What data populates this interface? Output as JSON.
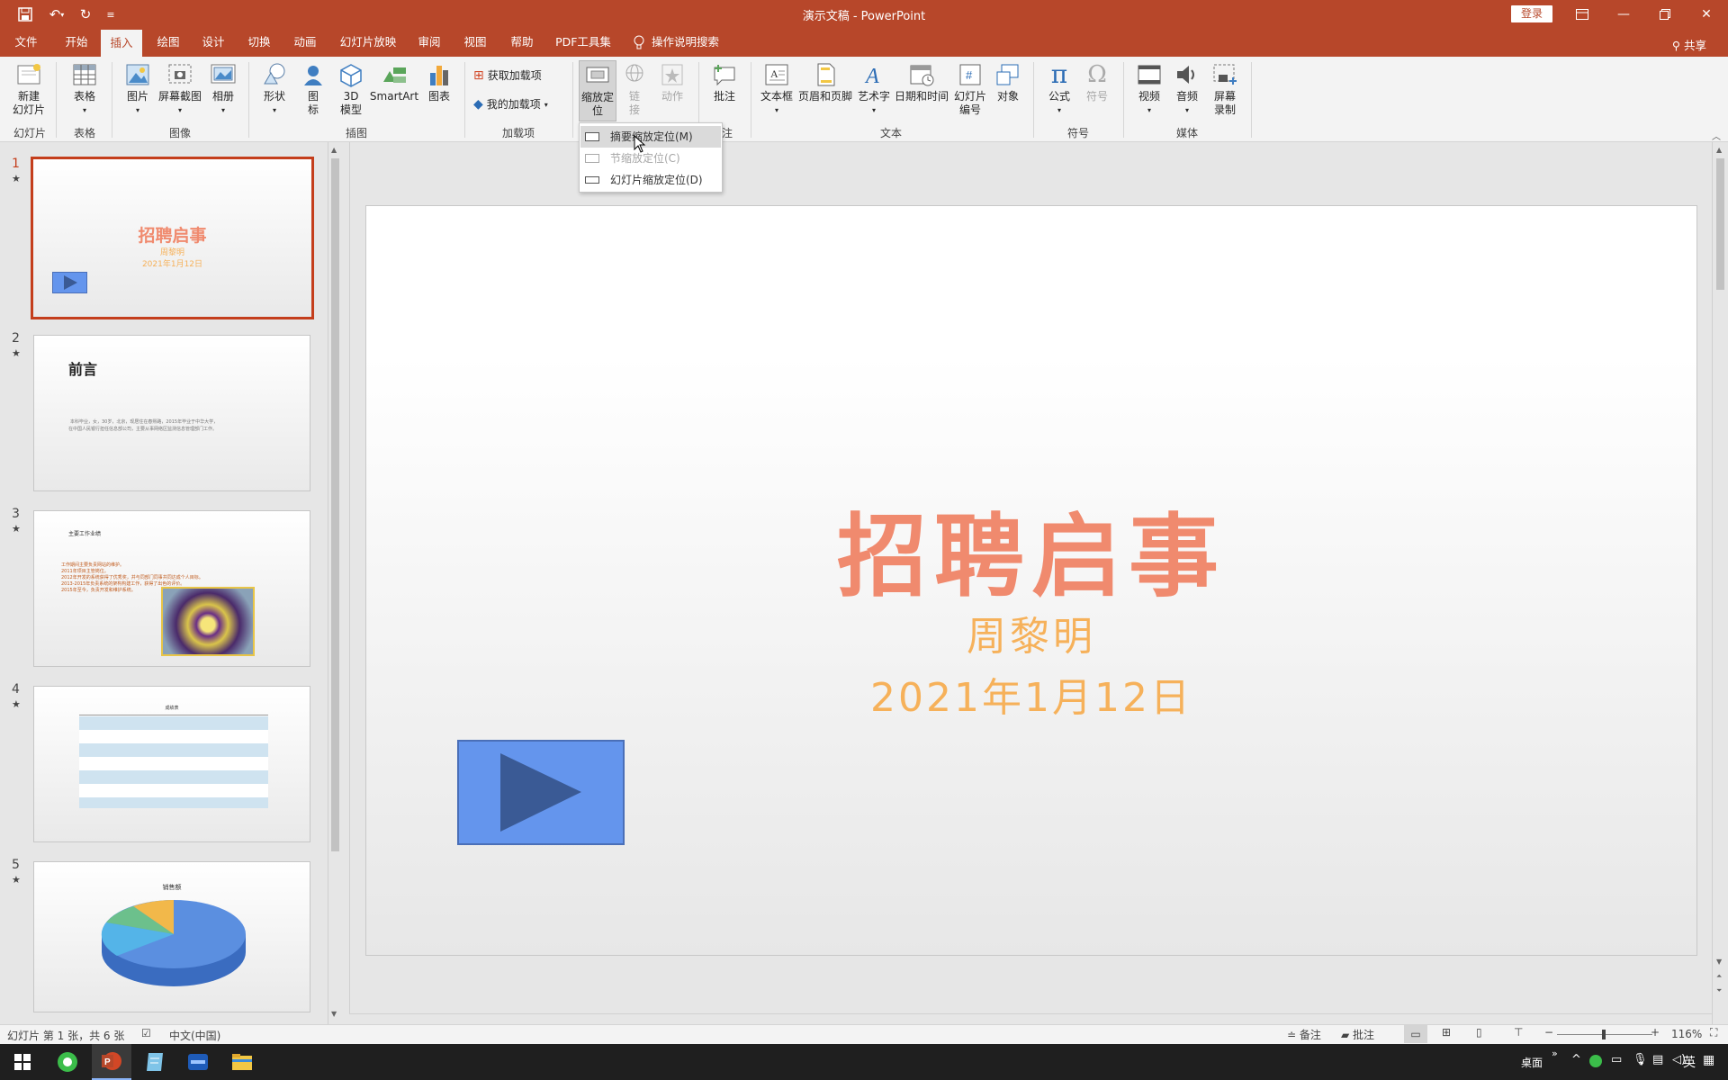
{
  "window": {
    "title": "演示文稿  -  PowerPoint",
    "login": "登录",
    "share": "共享"
  },
  "tabs": [
    "文件",
    "开始",
    "插入",
    "绘图",
    "设计",
    "切换",
    "动画",
    "幻灯片放映",
    "审阅",
    "视图",
    "帮助",
    "PDF工具集"
  ],
  "tell_me": "操作说明搜索",
  "ribbon": {
    "new_slide": "新建\n幻灯片",
    "table": "表格",
    "picture": "图片",
    "screenshot": "屏幕截图",
    "album": "相册",
    "shapes": "形状",
    "icons": "图\n标",
    "model3d": "3D\n模型",
    "smartart": "SmartArt",
    "chart": "图表",
    "get_addins": "获取加载项",
    "my_addins": "我的加载项",
    "zoom": "缩放定\n位",
    "link": "链\n接",
    "action": "动作",
    "comment": "批注",
    "textbox": "文本框",
    "header_footer": "页眉和页脚",
    "wordart": "艺术字",
    "datetime": "日期和时间",
    "slide_number": "幻灯片\n编号",
    "object": "对象",
    "equation": "公式",
    "symbol": "符号",
    "video": "视频",
    "audio": "音频",
    "screen_rec": "屏幕\n录制",
    "groups": {
      "slides": "幻灯片",
      "tables": "表格",
      "images": "图像",
      "illustrations": "插图",
      "addins": "加载项",
      "comments": "注",
      "text": "文本",
      "symbols": "符号",
      "media": "媒体"
    }
  },
  "zoom_menu": {
    "items": [
      "摘要缩放定位(M)",
      "节缩放定位(C)",
      "幻灯片缩放定位(D)"
    ]
  },
  "thumbs": {
    "numbers": [
      "1",
      "2",
      "3",
      "4",
      "5"
    ],
    "s1": {
      "title": "招聘启事",
      "sub": "周黎明",
      "date": "2021年1月12日"
    },
    "s2": {
      "title": "前言",
      "line1": "本科毕业，女，30岁，北京，现居住在春熙路，2015年毕业于中华大学，",
      "line2": "在中国人民银行担任信息部公司，主要从事网络区监测信息管理部门工作。"
    },
    "s3": {
      "title": "主要工作业绩",
      "l1": "工作期间主要负责网站的维护。",
      "l2": "2011年项目主管岗位。",
      "l3": "2012年开发的系统获得了优秀奖，并与同部门同事共同达成个人目标。",
      "l4": "2013-2015年负责系统的架构构建工作，获得了出色的评价。",
      "l5": "2015年至今，负责开发和维护系统。"
    },
    "s4": {
      "title": "成绩表"
    },
    "s5": {
      "title": "销售额"
    }
  },
  "slide": {
    "title": "招聘启事",
    "subtitle": "周黎明",
    "date": "2021年1月12日"
  },
  "status": {
    "slide_info": "幻灯片 第 1 张，共 6 张",
    "language": "中文(中国)",
    "notes": "备注",
    "comments": "批注",
    "zoom": "116%"
  },
  "tray": {
    "desktop": "桌面",
    "ime": "英"
  },
  "colors": {
    "accent": "#b7472a",
    "slide_title": "#f08a6e",
    "slide_sub": "#f6b15a",
    "play_fill": "#6495ed",
    "play_border": "#4a6fb8",
    "play_triangle": "#3a5a95"
  }
}
